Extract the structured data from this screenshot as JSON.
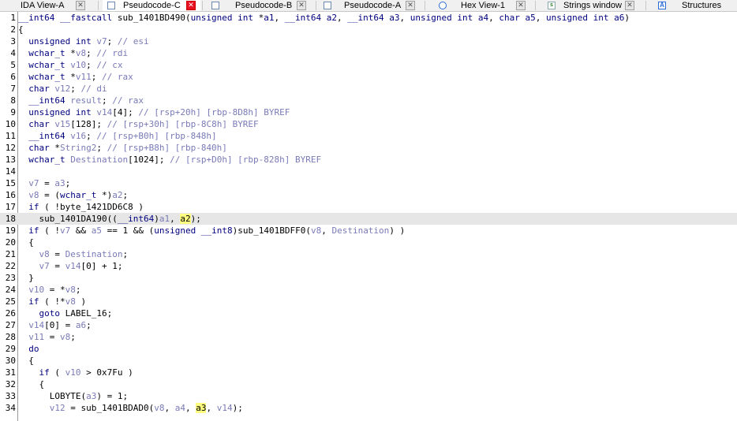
{
  "tabs": [
    {
      "label": "IDA View-A",
      "icon": "doc-icon",
      "active": false
    },
    {
      "label": "Pseudocode-C",
      "icon": "doc-icon",
      "active": true
    },
    {
      "label": "Pseudocode-B",
      "icon": "doc-icon",
      "active": false
    },
    {
      "label": "Pseudocode-A",
      "icon": "doc-icon",
      "active": false
    },
    {
      "label": "Hex View-1",
      "icon": "hex-icon",
      "active": false
    },
    {
      "label": "Strings window",
      "icon": "strings-icon",
      "active": false
    },
    {
      "label": "Structures",
      "icon": "structures-icon",
      "active": false
    }
  ],
  "tab_close_glyph": "✕",
  "colors": {
    "keyword": "#000080",
    "variable": "#7a7ab8",
    "comment": "#7a7ab8",
    "highlight_line": "#e6e6e6",
    "active_close": "#e81123"
  },
  "code": {
    "lines": [
      {
        "n": "1",
        "text": "__int64 __fastcall sub_1401BD490(unsigned int *a1, __int64 a2, __int64 a3, unsigned int a4, char a5, unsigned int a6)"
      },
      {
        "n": "2",
        "text": "{"
      },
      {
        "n": "3",
        "text": "  unsigned int v7; // esi"
      },
      {
        "n": "4",
        "text": "  wchar_t *v8; // rdi"
      },
      {
        "n": "5",
        "text": "  wchar_t v10; // cx"
      },
      {
        "n": "6",
        "text": "  wchar_t *v11; // rax"
      },
      {
        "n": "7",
        "text": "  char v12; // di"
      },
      {
        "n": "8",
        "text": "  __int64 result; // rax"
      },
      {
        "n": "9",
        "text": "  unsigned int v14[4]; // [rsp+20h] [rbp-8D8h] BYREF"
      },
      {
        "n": "10",
        "text": "  char v15[128]; // [rsp+30h] [rbp-8C8h] BYREF"
      },
      {
        "n": "11",
        "text": "  __int64 v16; // [rsp+B0h] [rbp-848h]"
      },
      {
        "n": "12",
        "text": "  char *String2; // [rsp+B8h] [rbp-840h]"
      },
      {
        "n": "13",
        "text": "  wchar_t Destination[1024]; // [rsp+D0h] [rbp-828h] BYREF"
      },
      {
        "n": "14",
        "text": ""
      },
      {
        "n": "15",
        "text": "  v7 = a3;"
      },
      {
        "n": "16",
        "text": "  v8 = (wchar_t *)a2;"
      },
      {
        "n": "17",
        "text": "  if ( !byte_1421DD6C8 )"
      },
      {
        "n": "18",
        "text": "    sub_1401DA190((__int64)a1, a2);"
      },
      {
        "n": "19",
        "text": "  if ( !v7 && a5 == 1 && (unsigned __int8)sub_1401BDFF0(v8, Destination) )"
      },
      {
        "n": "20",
        "text": "  {"
      },
      {
        "n": "21",
        "text": "    v8 = Destination;"
      },
      {
        "n": "22",
        "text": "    v7 = v14[0] + 1;"
      },
      {
        "n": "23",
        "text": "  }"
      },
      {
        "n": "24",
        "text": "  v10 = *v8;"
      },
      {
        "n": "25",
        "text": "  if ( !*v8 )"
      },
      {
        "n": "26",
        "text": "    goto LABEL_16;"
      },
      {
        "n": "27",
        "text": "  v14[0] = a6;"
      },
      {
        "n": "28",
        "text": "  v11 = v8;"
      },
      {
        "n": "29",
        "text": "  do"
      },
      {
        "n": "30",
        "text": "  {"
      },
      {
        "n": "31",
        "text": "    if ( v10 > 0x7Fu )"
      },
      {
        "n": "32",
        "text": "    {"
      },
      {
        "n": "33",
        "text": "      LOBYTE(a3) = 1;"
      },
      {
        "n": "34",
        "text": "      v12 = sub_1401BDAD0(v8, a4, a3, v14);"
      }
    ]
  }
}
